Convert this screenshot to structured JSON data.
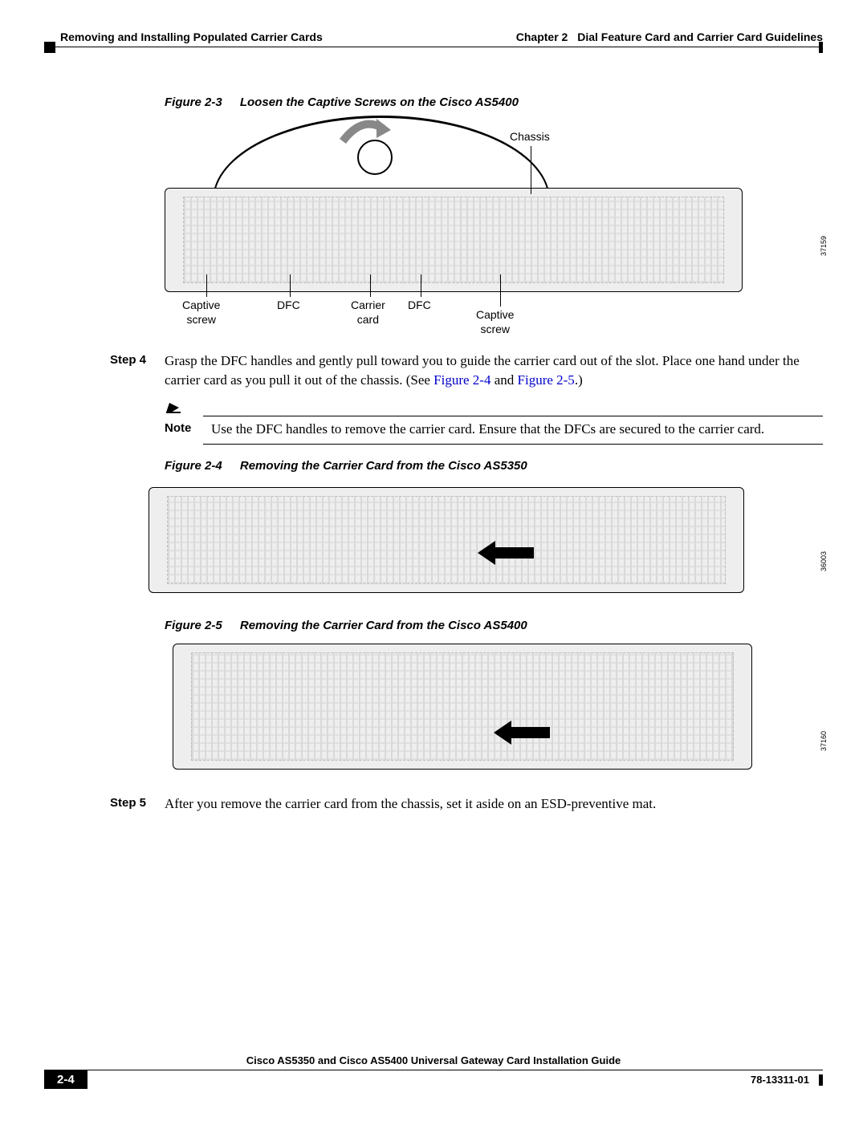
{
  "header": {
    "chapter_label": "Chapter 2",
    "chapter_title": "Dial Feature Card and Carrier Card Guidelines",
    "section_title": "Removing and Installing Populated Carrier Cards"
  },
  "figures": {
    "fig1": {
      "num": "Figure 2-3",
      "title": "Loosen the Captive Screws on the Cisco AS5400",
      "callouts": {
        "chassis": "Chassis",
        "captive_l_1": "Captive",
        "captive_l_2": "screw",
        "dfc1": "DFC",
        "carrier_1": "Carrier",
        "carrier_2": "card",
        "dfc2": "DFC",
        "captive_r_1": "Captive",
        "captive_r_2": "screw"
      },
      "sidecode": "37159"
    },
    "fig2": {
      "num": "Figure 2-4",
      "title": "Removing the Carrier Card from the Cisco AS5350",
      "sidecode": "36003"
    },
    "fig3": {
      "num": "Figure 2-5",
      "title": "Removing the Carrier Card from the Cisco AS5400",
      "sidecode": "37160"
    }
  },
  "steps": {
    "step4_label": "Step 4",
    "step4_body_a": "Grasp the DFC handles and gently pull toward you to guide the carrier card out of the slot. Place one hand under the carrier card as you pull it out of the chassis. (See ",
    "step4_xref1": "Figure 2-4",
    "step4_mid": " and ",
    "step4_xref2": "Figure 2-5",
    "step4_tail": ".)",
    "step5_label": "Step 5",
    "step5_body": "After you remove the carrier card from the chassis, set it aside on an ESD-preventive mat."
  },
  "note": {
    "label": "Note",
    "body": "Use the DFC handles to remove the carrier card. Ensure that the DFCs are secured to the carrier card."
  },
  "footer": {
    "guide_title": "Cisco AS5350 and Cisco AS5400 Universal Gateway Card Installation Guide",
    "page_num": "2-4",
    "doc_num": "78-13311-01"
  }
}
